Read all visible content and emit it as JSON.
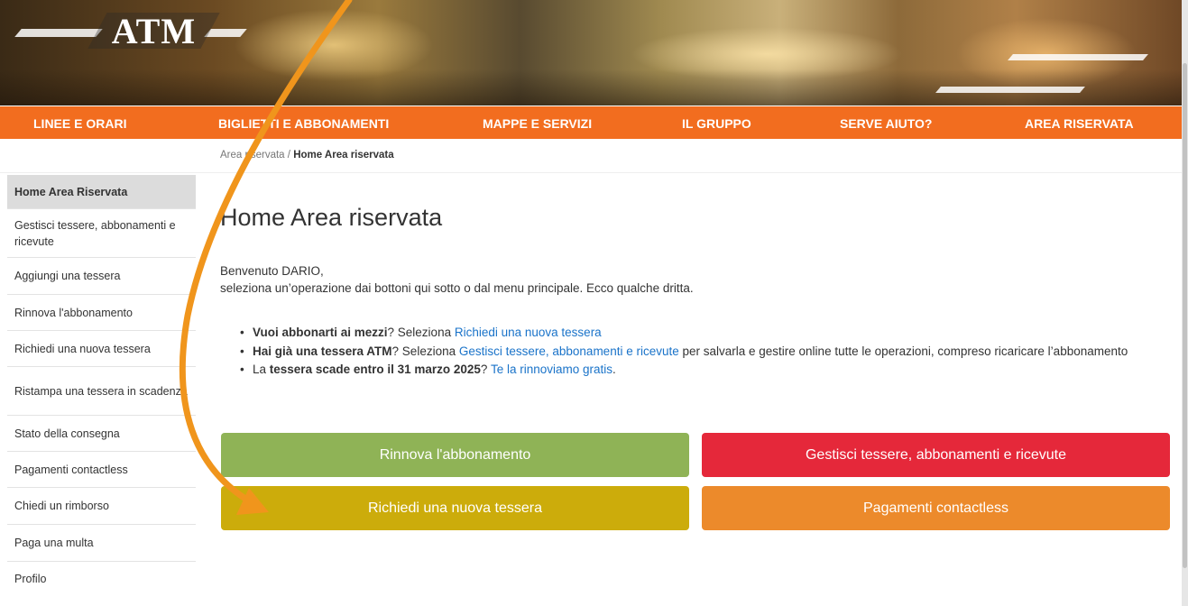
{
  "header": {
    "logo": "ATM",
    "nav": [
      "LINEE E ORARI",
      "BIGLIETTI E ABBONAMENTI",
      "MAPPE E SERVIZI",
      "IL GRUPPO",
      "SERVE AIUTO?",
      "AREA RISERVATA"
    ]
  },
  "breadcrumb": {
    "parent": "Area riservata",
    "separator": "/",
    "current": "Home Area riservata"
  },
  "sidebar": {
    "items": [
      "Home Area Riservata",
      "Gestisci tessere, abbonamenti e ricevute",
      "Aggiungi una tessera",
      "Rinnova l'abbonamento",
      "Richiedi una nuova tessera",
      "Ristampa una tessera in scadenza",
      "Stato della consegna",
      "Pagamenti contactless",
      "Chiedi un rimborso",
      "Paga una multa",
      "Profilo"
    ]
  },
  "main": {
    "title": "Home Area riservata",
    "welcome_line1": "Benvenuto DARIO,",
    "welcome_line2": "seleziona un’operazione dai bottoni qui sotto o dal menu principale. Ecco qualche dritta.",
    "tips": [
      {
        "bold": "Vuoi abbonarti ai mezzi",
        "text1": "? Seleziona ",
        "link": "Richiedi una nuova tessera",
        "text2": ""
      },
      {
        "bold": "Hai già una tessera ATM",
        "text1": "? Seleziona ",
        "link": "Gestisci tessere, abbonamenti e ricevute",
        "text2": " per salvarla e gestire online tutte le operazioni, compreso ricaricare l’abbonamento"
      },
      {
        "prefix": "La ",
        "bold": "tessera scade entro il 31 marzo 2025",
        "text1": "? ",
        "link": "Te la rinnoviamo gratis",
        "text2": "."
      }
    ],
    "buttons": {
      "renew": "Rinnova l'abbonamento",
      "manage": "Gestisci tessere, abbonamenti e ricevute",
      "new_card": "Richiedi una nuova tessera",
      "contactless": "Pagamenti contactless"
    }
  },
  "colors": {
    "nav": "#f26d1f",
    "renew_button": "#8fb356",
    "manage_button": "#e5283a",
    "new_card_button": "#ccac0b",
    "contactless_button": "#ec8a2b",
    "link": "#1a73c9",
    "annotation_arrow": "#f0951c"
  }
}
